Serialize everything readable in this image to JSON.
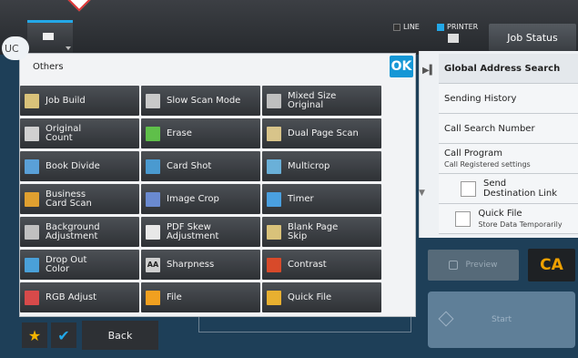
{
  "topbar": {
    "line_label": "LINE",
    "printer_label": "PRINTER",
    "job_status_label": "Job Status"
  },
  "badge": {
    "text": "UC"
  },
  "dialog": {
    "title": "Others",
    "ok_label": "OK",
    "rows": [
      [
        {
          "label": "Job Build",
          "icon": "job-build-icon"
        },
        {
          "label": "Slow Scan Mode",
          "icon": "slow-scan-icon"
        },
        {
          "label": "Mixed Size\nOriginal",
          "icon": "mixed-size-icon"
        }
      ],
      [
        {
          "label": "Original\nCount",
          "icon": "original-count-icon"
        },
        {
          "label": "Erase",
          "icon": "erase-icon"
        },
        {
          "label": "Dual Page Scan",
          "icon": "dual-page-icon"
        }
      ],
      [
        {
          "label": "Book Divide",
          "icon": "book-divide-icon"
        },
        {
          "label": "Card Shot",
          "icon": "card-shot-icon"
        },
        {
          "label": "Multicrop",
          "icon": "multicrop-icon"
        }
      ],
      [
        {
          "label": "Business\nCard Scan",
          "icon": "business-card-icon"
        },
        {
          "label": "Image Crop",
          "icon": "image-crop-icon"
        },
        {
          "label": "Timer",
          "icon": "timer-icon"
        }
      ],
      [
        {
          "label": "Background\nAdjustment",
          "icon": "background-adjust-icon"
        },
        {
          "label": "PDF Skew\nAdjustment",
          "icon": "pdf-skew-icon"
        },
        {
          "label": "Blank Page\nSkip",
          "icon": "blank-page-icon"
        }
      ],
      [
        {
          "label": "Drop Out\nColor",
          "icon": "drop-out-color-icon"
        },
        {
          "label": "Sharpness",
          "icon": "sharpness-icon",
          "icon_text": "AA"
        },
        {
          "label": "Contrast",
          "icon": "contrast-icon"
        }
      ],
      [
        {
          "label": "RGB Adjust",
          "icon": "rgb-adjust-icon"
        },
        {
          "label": "File",
          "icon": "folder-icon"
        },
        {
          "label": "Quick File",
          "icon": "quick-file-icon"
        }
      ]
    ]
  },
  "right_panel": {
    "global_search": "Global Address Search",
    "sending_history": "Sending History",
    "call_search_number": "Call Search Number",
    "call_program": "Call Program",
    "call_program_sub": "Call Registered settings",
    "send_destination_link": "Send\nDestination Link",
    "quick_file": "Quick File",
    "quick_file_sub": "Store Data Temporarily"
  },
  "controls": {
    "preview_label": "Preview",
    "ca_label": "CA",
    "start_label": "Start",
    "back_label": "Back"
  },
  "colors": {
    "accent": "#1597d6",
    "ca_text": "#f0a100",
    "star": "#f3b400"
  }
}
